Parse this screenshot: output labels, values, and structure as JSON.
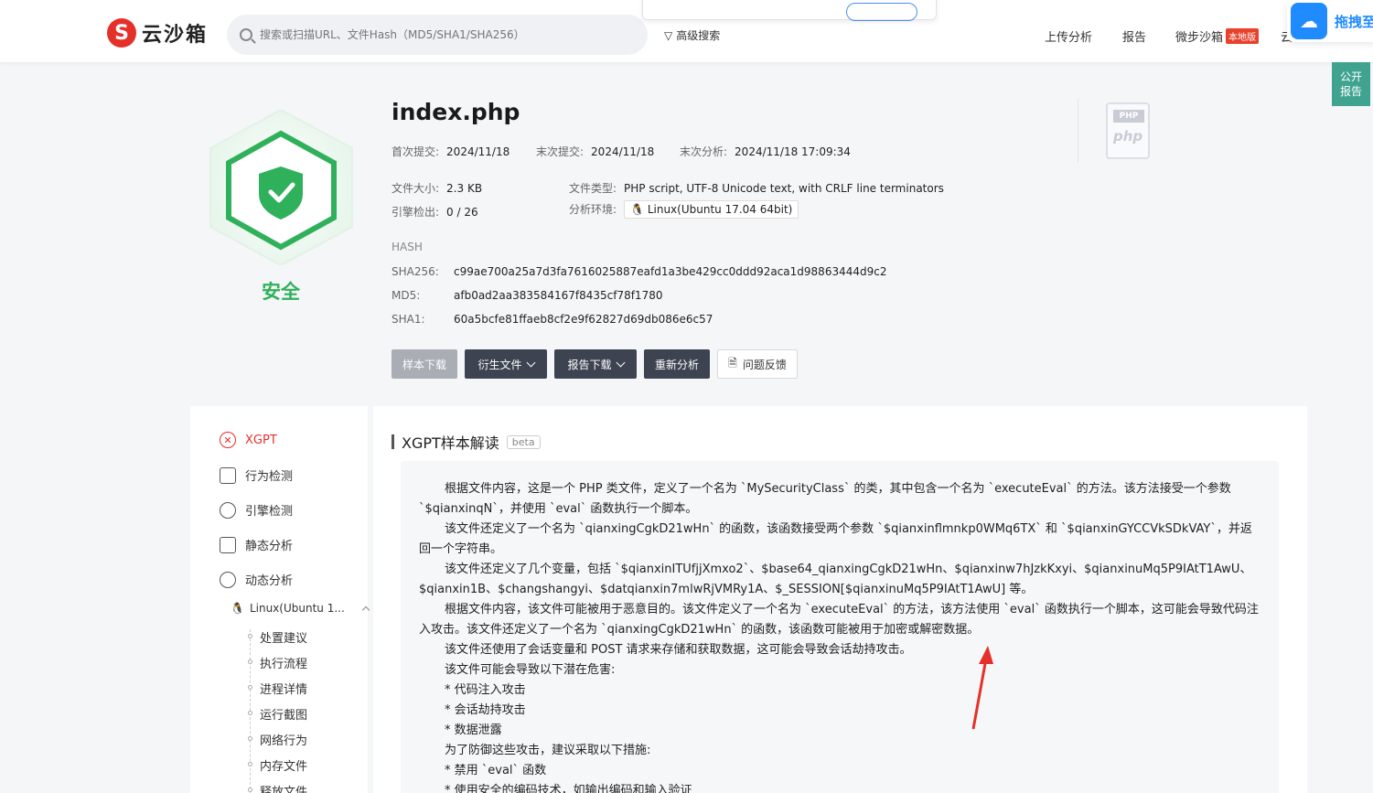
{
  "header": {
    "logo_mark": "S",
    "logo_text": "云沙箱",
    "search_placeholder": "搜索或扫描URL、文件Hash（MD5/SHA1/SHA256）",
    "advanced_search": "高级搜索",
    "nav": {
      "upload": "上传分析",
      "report": "报告",
      "micro_sandbox": "微步沙箱",
      "micro_badge": "本地版",
      "cut_item": "云"
    },
    "drag_button": "拖拽至",
    "public_report_1": "公开",
    "public_report_2": "报告"
  },
  "summary": {
    "status": "安全",
    "file_name": "index.php",
    "first_submit_label": "首次提交:",
    "first_submit": "2024/11/18",
    "last_submit_label": "末次提交:",
    "last_submit": "2024/11/18",
    "last_analysis_label": "末次分析:",
    "last_analysis": "2024/11/18 17:09:34",
    "size_label": "文件大小:",
    "size": "2.3 KB",
    "type_label": "文件类型:",
    "type": "PHP script, UTF-8 Unicode text, with CRLF line terminators",
    "engine_label": "引擎检出:",
    "engine": "0 / 26",
    "env_label": "分析环境:",
    "env": "Linux(Ubuntu 17.04 64bit)",
    "hash_heading": "HASH",
    "sha256_label": "SHA256:",
    "sha256": "c99ae700a25a7d3fa7616025887eafd1a3be429cc0ddd92aca1d98863444d9c2",
    "md5_label": "MD5:",
    "md5": "afb0ad2aa383584167f8435cf78f1780",
    "sha1_label": "SHA1:",
    "sha1": "60a5bcfe81ffaeb8cf2e9f62827d69db086e6c57",
    "php_tag": "PHP",
    "php_text": "php"
  },
  "actions": {
    "download_sample": "样本下载",
    "derived_files": "衍生文件",
    "report_download": "报告下载",
    "reanalyze": "重新分析",
    "feedback": "问题反馈"
  },
  "sidebar": {
    "xgpt": "XGPT",
    "behavior": "行为检测",
    "engine": "引擎检测",
    "static": "静态分析",
    "dynamic": "动态分析",
    "env": "Linux(Ubuntu 1...",
    "sub": [
      "处置建议",
      "执行流程",
      "进程详情",
      "运行截图",
      "网络行为",
      "内存文件",
      "释放文件"
    ]
  },
  "xgpt": {
    "title": "XGPT样本解读",
    "beta": "beta",
    "p1": "根据文件内容，这是一个 PHP 类文件，定义了一个名为 `MySecurityClass` 的类，其中包含一个名为 `executeEval` 的方法。该方法接受一个参数 `$qianxinqN`，并使用 `eval` 函数执行一个脚本。",
    "p2": "该文件还定义了一个名为 `qianxingCgkD21wHn` 的函数，该函数接受两个参数 `$qianxinflmnkp0WMq6TX` 和 `$qianxinGYCCVkSDkVAY`，并返回一个字符串。",
    "p3": "该文件还定义了几个变量，包括 `$qianxinITUfjjXmxo2`、$base64_qianxingCgkD21wHn、$qianxinw7hJzkKxyi、$qianxinuMq5P9IAtT1AwU、$qianxin1B、$changshangyi、$datqianxin7mlwRjVMRy1A、$_SESSION[$qianxinuMq5P9IAtT1AwU] 等。",
    "p4": "根据文件内容，该文件可能被用于恶意目的。该文件定义了一个名为 `executeEval` 的方法，该方法使用 `eval` 函数执行一个脚本，这可能会导致代码注入攻击。该文件还定义了一个名为 `qianxingCgkD21wHn` 的函数，该函数可能被用于加密或解密数据。",
    "p5": "该文件还使用了会话变量和 POST 请求来存储和获取数据，这可能会导致会话劫持攻击。",
    "p6": "该文件可能会导致以下潜在危害:",
    "l1": "* 代码注入攻击",
    "l2": "* 会话劫持攻击",
    "l3": "* 数据泄露",
    "p7": "为了防御这些攻击，建议采取以下措施:",
    "l4": "* 禁用 `eval` 函数",
    "l5": "* 使用安全的编码技术，如输出编码和输入验证"
  },
  "colors": {
    "safe_green": "#2fb05a",
    "brand_red": "#e5302a",
    "dark_button": "#3d4350"
  }
}
